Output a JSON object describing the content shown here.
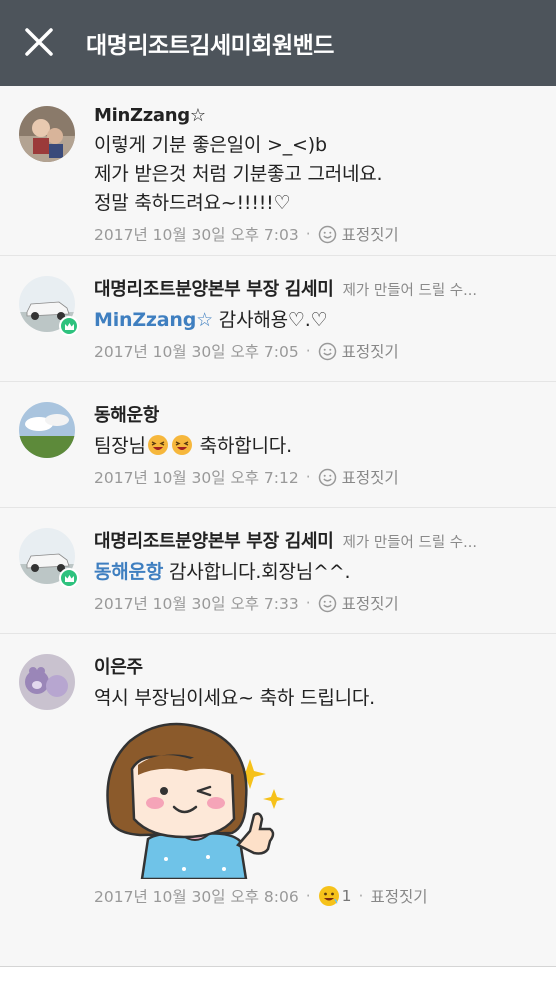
{
  "header": {
    "title": "대명리조트김세미회원밴드"
  },
  "comments": [
    {
      "name": "MinZzang☆",
      "lines": [
        "이렇게 기분 좋은일이 >_<)b",
        "제가 받은것 처럼 기분좋고 그러네요.",
        "정말 축하드려요~!!!!!♡"
      ],
      "timestamp": "2017년 10월 30일 오후 7:03",
      "react_label": "표정짓기"
    },
    {
      "name": "대명리조트분양본부 부장 김세미",
      "role": "제가 만들어 드릴 수...",
      "mention": "MinZzang☆",
      "text": " 감사해용♡.♡",
      "timestamp": "2017년 10월 30일 오후 7:05",
      "react_label": "표정짓기"
    },
    {
      "name": "동해운항",
      "text_before": "팀장님",
      "text_after": " 축하합니다.",
      "timestamp": "2017년 10월 30일 오후 7:12",
      "react_label": "표정짓기"
    },
    {
      "name": "대명리조트분양본부 부장 김세미",
      "role": "제가 만들어 드릴 수...",
      "mention": "동해운항",
      "text": " 감사합니다.회장님^^.",
      "timestamp": "2017년 10월 30일 오후 7:33",
      "react_label": "표정짓기"
    },
    {
      "name": "이은주",
      "text": "역시 부장님이세요~ 축하 드립니다.",
      "timestamp": "2017년 10월 30일 오후 8:06",
      "reaction_count": "1",
      "react_label": "표정짓기"
    }
  ],
  "colors": {
    "header_bg": "#4d545b",
    "mention": "#3f7fc0",
    "leader_badge": "#2ec27e"
  }
}
